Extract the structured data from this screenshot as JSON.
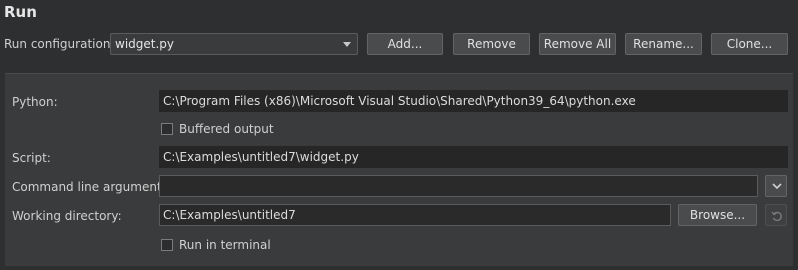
{
  "header": {
    "title": "Run"
  },
  "config": {
    "label": "Run configuration:",
    "selected": "widget.py",
    "buttons": {
      "add": "Add...",
      "remove": "Remove",
      "remove_all": "Remove All",
      "rename": "Rename...",
      "clone": "Clone..."
    }
  },
  "form": {
    "python_label": "Python:",
    "python_value": "C:\\Program Files (x86)\\Microsoft Visual Studio\\Shared\\Python39_64\\python.exe",
    "buffered_label": "Buffered output",
    "buffered_checked": false,
    "script_label": "Script:",
    "script_value": "C:\\Examples\\untitled7\\widget.py",
    "args_label": "Command line arguments:",
    "args_value": "",
    "workdir_label": "Working directory:",
    "workdir_value": "C:\\Examples\\untitled7",
    "browse_label": "Browse...",
    "terminal_label": "Run in terminal",
    "terminal_checked": false
  },
  "icons": {
    "args_dropdown": "chevron-down-icon",
    "workdir_reset": "undo-icon"
  }
}
